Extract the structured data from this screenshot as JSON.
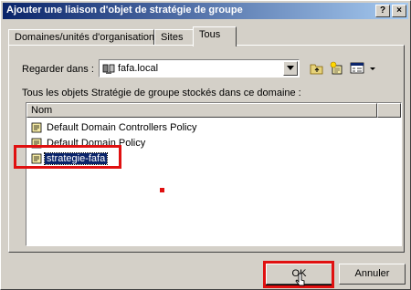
{
  "window": {
    "title": "Ajouter une liaison d'objet de stratégie de groupe",
    "help_glyph": "?",
    "close_glyph": "×"
  },
  "tabs": [
    {
      "label": "Domaines/unités d'organisation",
      "active": false
    },
    {
      "label": "Sites",
      "active": false
    },
    {
      "label": "Tous",
      "active": true
    }
  ],
  "lookin": {
    "label": "Regarder dans :",
    "value": "fafa.local"
  },
  "list": {
    "caption": "Tous les objets Stratégie de groupe stockés dans ce domaine :",
    "column_header": "Nom",
    "items": [
      {
        "label": "Default Domain Controllers Policy",
        "selected": false
      },
      {
        "label": "Default Domain Policy",
        "selected": false
      },
      {
        "label": "strategie-fafa",
        "selected": true
      }
    ]
  },
  "buttons": {
    "ok": "OK",
    "cancel": "Annuler"
  },
  "icons": {
    "lookin_domain": "domain-icon",
    "up_folder": "up-folder-icon",
    "new_gpo": "new-gpo-icon",
    "view_menu": "view-menu-icon",
    "gpo": "gpo-scroll-icon"
  },
  "colors": {
    "titlebar_start": "#0a246a",
    "titlebar_end": "#a6caf0",
    "selection": "#0a246a",
    "annotation_red": "#e01010"
  }
}
